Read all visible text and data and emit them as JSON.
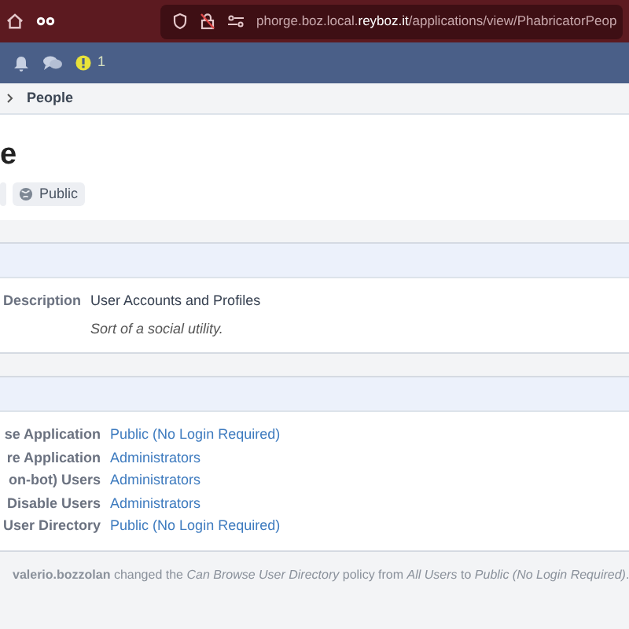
{
  "browser": {
    "url_prefix": "phorge.boz.local.",
    "url_domain": "reyboz.it",
    "url_path": "/applications/view/PhabricatorPeop"
  },
  "topbar": {
    "alert_count": "1"
  },
  "breadcrumb": {
    "label": "People"
  },
  "header": {
    "title": "e",
    "tags": [
      {
        "label": "Public"
      }
    ]
  },
  "sections": [
    {
      "kind": "details",
      "rows": [
        {
          "label": "Description",
          "value": "User Accounts and Profiles",
          "note": "Sort of a social utility."
        }
      ]
    },
    {
      "kind": "policies",
      "rows": [
        {
          "label": "se Application",
          "value": "Public (No Login Required)"
        },
        {
          "label": "re Application",
          "value": "Administrators"
        },
        {
          "label": "on-bot) Users",
          "value": "Administrators"
        },
        {
          "label": "Disable Users",
          "value": "Administrators"
        },
        {
          "label": "User Directory",
          "value": "Public (No Login Required)"
        }
      ]
    }
  ],
  "timeline": [
    {
      "text": "**valerio.bozzolan** changed the *Can Browse User Directory* policy from *All Users* to *Public (No Login Required)*."
    }
  ]
}
